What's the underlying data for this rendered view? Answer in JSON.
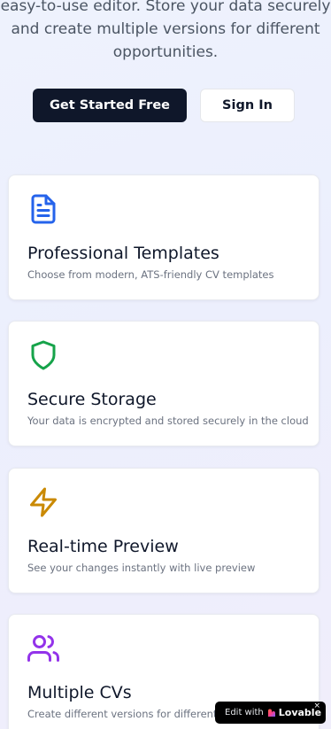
{
  "hero": {
    "line1": "easy-to-use editor. Store your data securely",
    "line2": "and create multiple versions for different",
    "line3": "opportunities."
  },
  "buttons": {
    "primary_label": "Get Started Free",
    "secondary_label": "Sign In"
  },
  "features": [
    {
      "icon": "document-icon",
      "icon_color": "#2563eb",
      "title": "Professional Templates",
      "description": "Choose from modern, ATS-friendly CV templates"
    },
    {
      "icon": "shield-icon",
      "icon_color": "#16a34a",
      "title": "Secure Storage",
      "description": "Your data is encrypted and stored securely in the cloud"
    },
    {
      "icon": "lightning-icon",
      "icon_color": "#ca8a04",
      "title": "Real-time Preview",
      "description": "See your changes instantly with live preview"
    },
    {
      "icon": "users-icon",
      "icon_color": "#9333ea",
      "title": "Multiple CVs",
      "description": "Create different versions for different jobs"
    }
  ],
  "badge": {
    "edit_with": "Edit with",
    "brand": "Lovable",
    "close": "×"
  },
  "colors": {
    "primary_button_bg": "#0f172a",
    "background": "#eef2fd"
  }
}
